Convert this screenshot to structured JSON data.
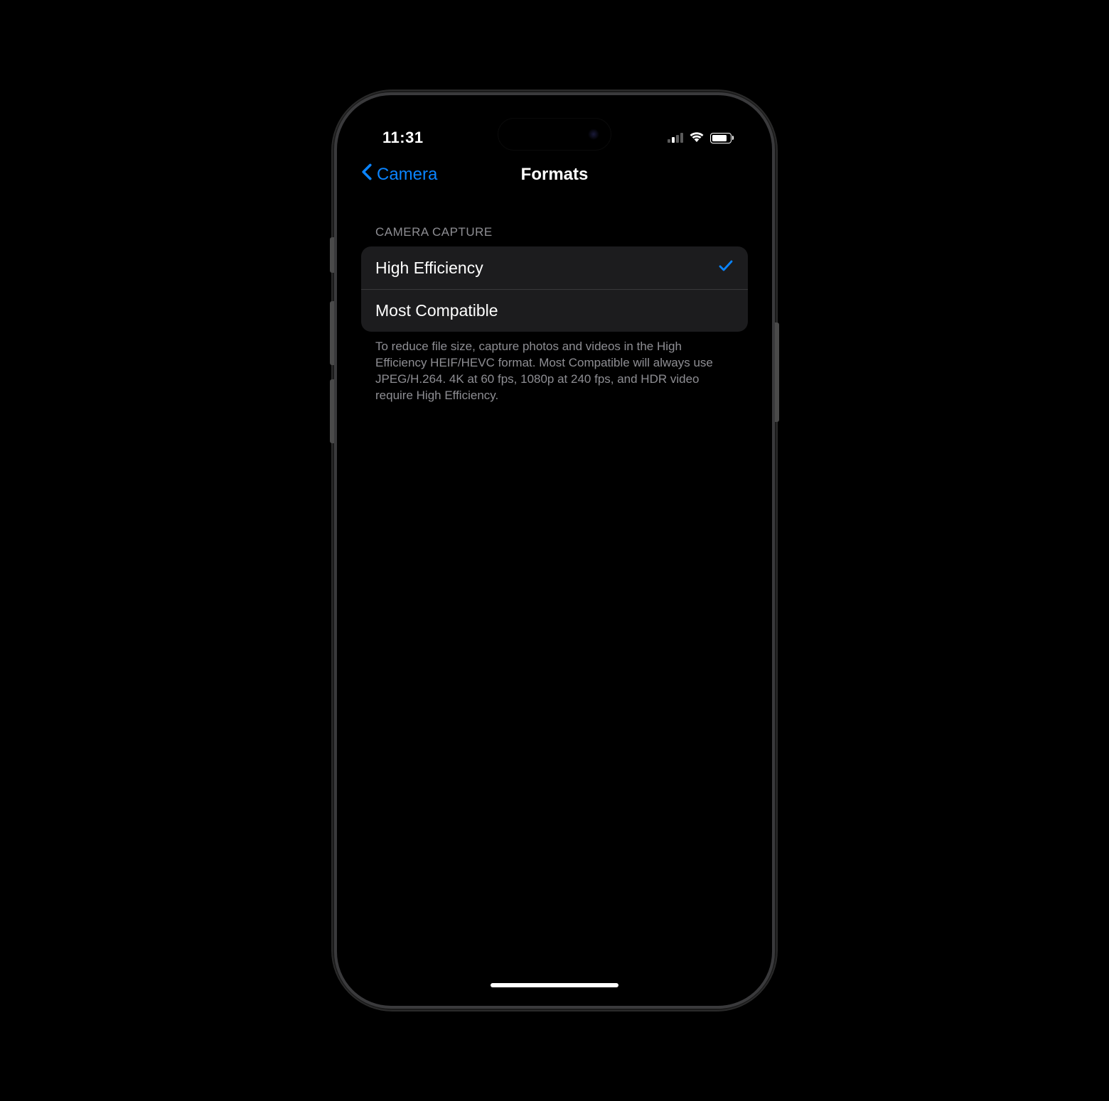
{
  "statusBar": {
    "time": "11:31"
  },
  "nav": {
    "back_label": "Camera",
    "title": "Formats"
  },
  "section": {
    "header": "CAMERA CAPTURE",
    "options": [
      {
        "label": "High Efficiency",
        "selected": true
      },
      {
        "label": "Most Compatible",
        "selected": false
      }
    ],
    "footer": "To reduce file size, capture photos and videos in the High Efficiency HEIF/HEVC format. Most Compatible will always use JPEG/H.264. 4K at 60 fps, 1080p at 240 fps, and HDR video require High Efficiency."
  },
  "colors": {
    "accent": "#0a84ff",
    "background": "#000000",
    "cell": "#1c1c1e",
    "secondary_text": "#8e8e93"
  }
}
